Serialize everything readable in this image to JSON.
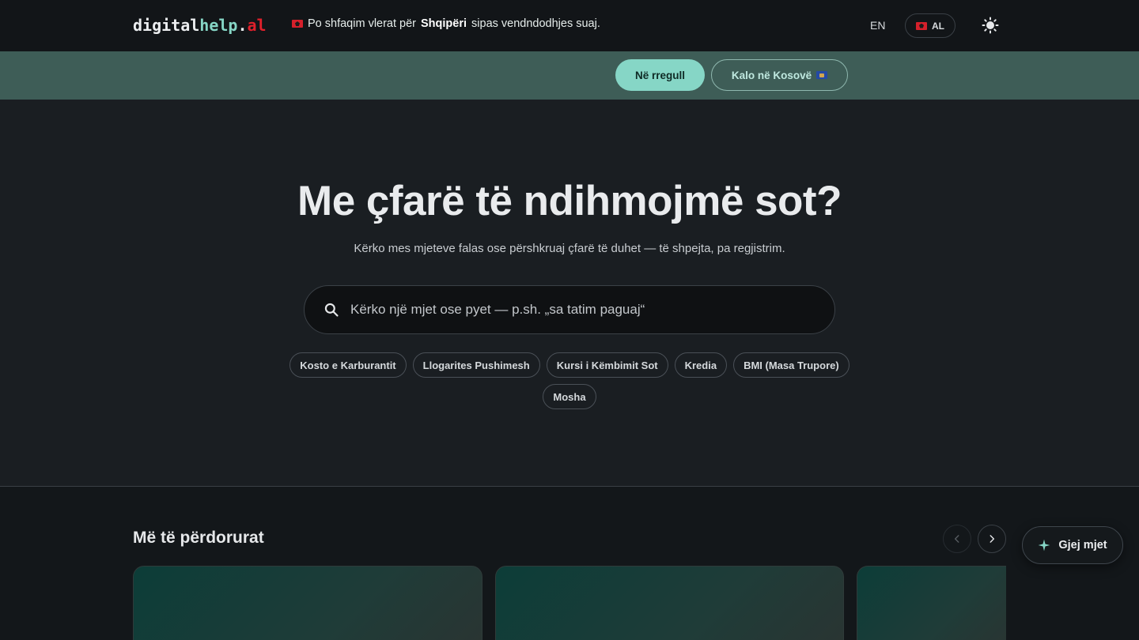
{
  "header": {
    "logo": {
      "part1": "digital",
      "part2": "help",
      "part3": ".",
      "part4": "al"
    },
    "lang_en": "EN",
    "lang_al": "AL",
    "theme_icon": "sun-icon"
  },
  "banner": {
    "text_before": "Po shfaqim vlerat për",
    "country": "Shqipëri",
    "text_after": "sipas vendndodhjes suaj.",
    "confirm_label": "Në rregull",
    "switch_label": "Kalo në Kosovë"
  },
  "hero": {
    "title": "Me çfarë të ndihmojmë sot?",
    "subtitle": "Kërko mes mjeteve falas ose përshkruaj çfarë të duhet — të shpejta, pa regjistrim.",
    "search_placeholder": "Kërko një mjet ose pyet — p.sh. „sa tatim paguaj“"
  },
  "chips_row1": [
    "Kosto e Karburantit",
    "Llogarites Pushimesh",
    "Kursi i Këmbimit Sot",
    "Kredia",
    "BMI (Masa Trupore)"
  ],
  "chips_row2": [
    "Mosha"
  ],
  "popular": {
    "title": "Më të përdorurat"
  },
  "fab": {
    "label": "Gjej mjet",
    "icon": "sparkle-icon"
  },
  "colors": {
    "accent": "#86d6c6",
    "banner_bg": "#3e5d57",
    "logo_red": "#e0202b"
  }
}
